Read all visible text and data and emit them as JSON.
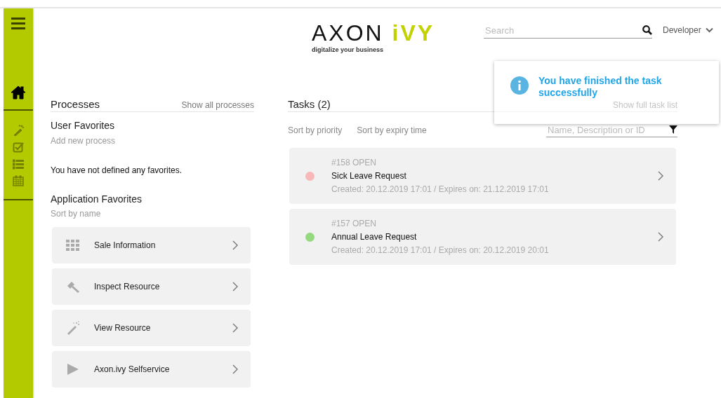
{
  "sidebar": {
    "items": [
      {
        "selected": true
      },
      {
        "selected": false
      },
      {
        "selected": false
      },
      {
        "selected": false
      },
      {
        "selected": false
      }
    ]
  },
  "header": {
    "logo": {
      "name_main": "AXON",
      "name_accent": "iVY",
      "tagline": "digitalize your business"
    },
    "search": {
      "placeholder": "Search"
    },
    "user": "Developer"
  },
  "notification": {
    "message": "You have finished the task successfully"
  },
  "processes": {
    "title": "Processes",
    "link": "Show all processes",
    "user_favorites": {
      "title": "User Favorites",
      "add": "Add new process",
      "empty": "You have not defined any favorites."
    },
    "application_favorites": {
      "title": "Application Favorites",
      "sort": "Sort by name",
      "items": [
        {
          "label": "Sale Information"
        },
        {
          "label": "Inspect Resource"
        },
        {
          "label": "View Resource"
        },
        {
          "label": "Axon.ivy Selfservice"
        }
      ]
    }
  },
  "tasks": {
    "title": "Tasks (2)",
    "link": "Show full task list",
    "sorts": [
      "Sort by priority",
      "Sort by expiry time"
    ],
    "filter": {
      "placeholder": "Name, Description or ID"
    },
    "items": [
      {
        "id": "#158 OPEN",
        "name": "Sick Leave Request",
        "dates": "Created: 20.12.2019 17:01 / Expires on: 21.12.2019 17:01",
        "color": "#f9b8b8"
      },
      {
        "id": "#157 OPEN",
        "name": "Annual Leave Request",
        "dates": "Created: 20.12.2019 17:01 / Expires on: 20.12.2019 20:01",
        "color": "#94d97e"
      }
    ]
  }
}
